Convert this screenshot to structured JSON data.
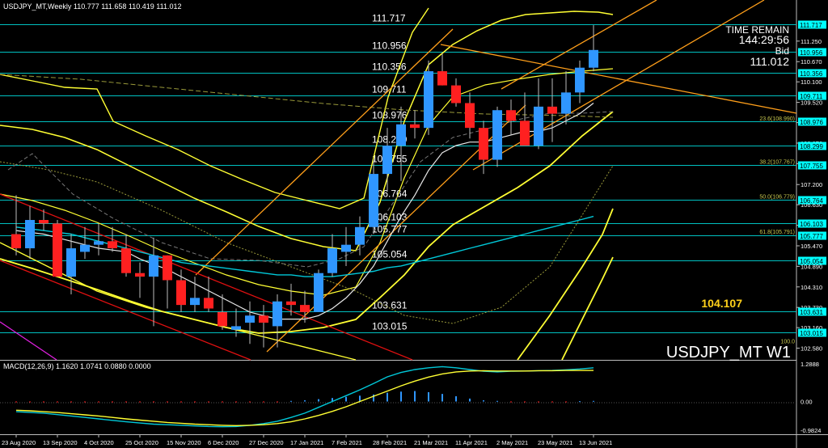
{
  "window": {
    "header": "USDJPY_MT,Weekly  110.777 111.658 110.419 111.012"
  },
  "overlay": {
    "time_remain_label": "TIME REMAIN",
    "time_remain_value": "144:29:56",
    "bid_label": "Bid",
    "bid_value": "111.012",
    "symbol_watermark": "USDJPY_MT W1",
    "highlight_price": "104.107"
  },
  "colors": {
    "background": "#000000",
    "bull": "#2f96ff",
    "bear": "#ff2020",
    "level_line": "#00c0c0",
    "price_box": "#00ffff",
    "channel": "#ff9f1a",
    "bands": "#ffff33",
    "ma_cyan": "#00c8d8",
    "highlight": "#ffd11a"
  },
  "chart_data": [
    {
      "type": "candlestick",
      "title": "USDJPY_MT,Weekly",
      "x": [
        "23 Aug 2020",
        "30 Aug 2020",
        "6 Sep 2020",
        "13 Sep 2020",
        "20 Sep 2020",
        "27 Sep 2020",
        "4 Oct 2020",
        "11 Oct 2020",
        "18 Oct 2020",
        "25 Oct 2020",
        "1 Nov 2020",
        "8 Nov 2020",
        "15 Nov 2020",
        "22 Nov 2020",
        "29 Nov 2020",
        "6 Dec 2020",
        "13 Dec 2020",
        "20 Dec 2020",
        "27 Dec 2020",
        "3 Jan 2021",
        "10 Jan 2021",
        "17 Jan 2021",
        "24 Jan 2021",
        "31 Jan 2021",
        "7 Feb 2021",
        "14 Feb 2021",
        "21 Feb 2021",
        "28 Feb 2021",
        "7 Mar 2021",
        "14 Mar 2021",
        "21 Mar 2021",
        "28 Mar 2021",
        "4 Apr 2021",
        "11 Apr 2021",
        "18 Apr 2021",
        "25 Apr 2021",
        "2 May 2021",
        "9 May 2021",
        "16 May 2021",
        "23 May 2021",
        "30 May 2021",
        "6 Jun 2021",
        "13 Jun 2021"
      ],
      "x_tick_labels": [
        "23 Aug 2020",
        "13 Sep 2020",
        "4 Oct 2020",
        "25 Oct 2020",
        "15 Nov 2020",
        "6 Dec 2020",
        "27 Dec 2020",
        "17 Jan 2021",
        "7 Feb 2021",
        "28 Feb 2021",
        "21 Mar 2021",
        "11 Apr 2021",
        "2 May 2021",
        "23 May 2021",
        "13 Jun 2021"
      ],
      "open": [
        105.8,
        105.4,
        106.2,
        106.1,
        104.6,
        105.3,
        105.5,
        105.6,
        105.4,
        104.7,
        104.6,
        105.2,
        104.5,
        103.8,
        104.0,
        103.6,
        103.1,
        103.3,
        103.5,
        103.2,
        103.9,
        103.8,
        103.6,
        104.7,
        105.3,
        105.5,
        106.0,
        107.5,
        108.3,
        108.9,
        108.8,
        110.4,
        110.0,
        109.5,
        108.8,
        107.9,
        109.3,
        109.0,
        108.3,
        109.4,
        109.2,
        109.8,
        110.5
      ],
      "high": [
        106.9,
        106.6,
        106.5,
        106.2,
        105.8,
        106.0,
        106.1,
        106.0,
        105.8,
        105.0,
        105.7,
        105.2,
        104.8,
        104.6,
        104.6,
        104.1,
        103.7,
        103.9,
        103.8,
        104.1,
        104.4,
        104.2,
        104.8,
        105.8,
        106.0,
        106.3,
        107.9,
        108.8,
        109.4,
        109.3,
        110.7,
        110.9,
        110.2,
        109.8,
        109.0,
        109.4,
        109.6,
        109.8,
        110.2,
        110.2,
        110.4,
        110.7,
        111.7
      ],
      "low": [
        105.2,
        105.1,
        105.9,
        104.7,
        104.1,
        105.1,
        105.2,
        105.3,
        104.6,
        104.0,
        103.2,
        103.7,
        103.6,
        103.6,
        103.6,
        103.1,
        102.9,
        102.7,
        102.6,
        102.6,
        103.5,
        103.3,
        103.6,
        104.6,
        104.9,
        105.2,
        105.8,
        107.0,
        107.3,
        108.5,
        108.6,
        110.0,
        109.4,
        108.5,
        107.5,
        107.7,
        108.6,
        108.4,
        108.2,
        108.4,
        108.9,
        109.5,
        110.4
      ],
      "close": [
        105.4,
        106.2,
        106.1,
        104.6,
        105.4,
        105.5,
        105.6,
        105.4,
        104.7,
        104.6,
        105.2,
        104.5,
        103.8,
        104.0,
        103.7,
        103.2,
        103.2,
        103.5,
        103.3,
        103.9,
        103.8,
        103.6,
        104.7,
        105.4,
        105.5,
        106.0,
        107.5,
        108.3,
        108.9,
        108.8,
        110.4,
        110.0,
        109.5,
        108.8,
        107.9,
        109.3,
        109.0,
        108.3,
        109.4,
        109.2,
        109.8,
        110.5,
        111.0
      ],
      "ylim": [
        102.25,
        112.0
      ],
      "y_tick_labels": [
        "111.250",
        "110.670",
        "110.100",
        "109.520",
        "108.950",
        "108.370",
        "107.790",
        "107.200",
        "106.630",
        "106.050",
        "105.470",
        "104.890",
        "104.310",
        "103.730",
        "103.160",
        "102.580"
      ],
      "horizontal_levels": [
        {
          "price": 111.717,
          "label": "111.717",
          "box": "111.717"
        },
        {
          "price": 110.956,
          "label": "110.956",
          "box": "110.956"
        },
        {
          "price": 110.356,
          "label": "110.356",
          "box": "110.356"
        },
        {
          "price": 109.711,
          "label": "109.711",
          "box": "109.711"
        },
        {
          "price": 108.976,
          "label": "108.976",
          "box": "108.976"
        },
        {
          "price": 108.299,
          "label": "108.299",
          "box": "108.299"
        },
        {
          "price": 107.755,
          "label": "107.755",
          "box": "107.755"
        },
        {
          "price": 106.764,
          "label": "106.764",
          "box": "106.764"
        },
        {
          "price": 106.103,
          "label": "106.103",
          "box": "106.103"
        },
        {
          "price": 105.777,
          "label": "105.777",
          "box": "105.777"
        },
        {
          "price": 105.054,
          "label": "105.054",
          "box": "105.054"
        },
        {
          "price": 103.631,
          "label": "103.631",
          "box": "103.631"
        },
        {
          "price": 103.015,
          "label": "103.015",
          "box": "103.015"
        }
      ],
      "fibonacci_labels": [
        {
          "price": 108.99,
          "text": "23.6(108.990)"
        },
        {
          "price": 107.767,
          "text": "38.2(107.767)"
        },
        {
          "price": 106.779,
          "text": "50.0(106.779)"
        },
        {
          "price": 105.791,
          "text": "61.8(105.791)"
        },
        {
          "price": 102.7,
          "text": "100.0"
        }
      ],
      "moving_average_cyan": [
        106.0,
        105.95,
        105.9,
        105.85,
        105.8,
        105.7,
        105.6,
        105.5,
        105.4,
        105.3,
        105.2,
        105.1,
        105.0,
        104.95,
        104.9,
        104.85,
        104.8,
        104.75,
        104.7,
        104.65,
        104.65,
        104.6,
        104.6,
        104.6,
        104.65,
        104.7,
        104.75,
        104.85,
        104.9,
        105.0,
        105.1,
        105.2,
        105.3,
        105.4,
        105.5,
        105.6,
        105.7,
        105.8,
        105.9,
        106.0,
        106.1,
        106.2,
        106.3
      ],
      "moving_average_white": [
        105.9,
        105.85,
        105.8,
        105.7,
        105.6,
        105.5,
        105.4,
        105.35,
        105.3,
        105.1,
        104.95,
        104.8,
        104.6,
        104.4,
        104.2,
        104.0,
        103.8,
        103.6,
        103.5,
        103.4,
        103.4,
        103.4,
        103.5,
        103.7,
        104.0,
        104.4,
        104.9,
        105.6,
        106.3,
        106.9,
        107.6,
        108.1,
        108.3,
        108.4,
        108.4,
        108.5,
        108.6,
        108.7,
        108.7,
        108.8,
        109.0,
        109.2,
        109.5
      ]
    },
    {
      "type": "bar",
      "title": "MACD(12,26,9) 1.1620 1.0741 0.0880 0.0000",
      "ylim": [
        -1.1,
        1.35
      ],
      "y_tick_labels": [
        "1.2888",
        "0.00",
        "-0.9824"
      ],
      "macd": [
        -0.35,
        -0.38,
        -0.4,
        -0.45,
        -0.5,
        -0.55,
        -0.6,
        -0.65,
        -0.7,
        -0.74,
        -0.78,
        -0.8,
        -0.82,
        -0.84,
        -0.86,
        -0.87,
        -0.86,
        -0.82,
        -0.76,
        -0.68,
        -0.55,
        -0.4,
        -0.2,
        0.0,
        0.2,
        0.4,
        0.62,
        0.85,
        1.0,
        1.1,
        1.16,
        1.2,
        1.16,
        1.1,
        1.04,
        1.02,
        1.04,
        1.05,
        1.06,
        1.07,
        1.09,
        1.12,
        1.16
      ],
      "signal": [
        -0.3,
        -0.32,
        -0.35,
        -0.38,
        -0.42,
        -0.46,
        -0.5,
        -0.55,
        -0.6,
        -0.64,
        -0.68,
        -0.72,
        -0.75,
        -0.78,
        -0.8,
        -0.82,
        -0.83,
        -0.82,
        -0.8,
        -0.76,
        -0.7,
        -0.6,
        -0.48,
        -0.34,
        -0.18,
        0.0,
        0.18,
        0.36,
        0.54,
        0.7,
        0.84,
        0.95,
        1.02,
        1.05,
        1.06,
        1.05,
        1.05,
        1.05,
        1.06,
        1.06,
        1.07,
        1.07,
        1.07
      ],
      "histogram": [
        0.0,
        0.0,
        0.0,
        0.0,
        0.0,
        0.0,
        0.0,
        0.0,
        0.0,
        0.0,
        0.0,
        0.0,
        0.0,
        0.0,
        0.0,
        0.0,
        0.0,
        0.0,
        0.0,
        0.0,
        0.02,
        0.04,
        0.08,
        0.12,
        0.16,
        0.2,
        0.24,
        0.3,
        0.34,
        0.36,
        0.32,
        0.26,
        0.18,
        0.1,
        0.04,
        0.02,
        0.0,
        0.0,
        0.0,
        0.0,
        0.0,
        0.01,
        0.02
      ]
    }
  ]
}
